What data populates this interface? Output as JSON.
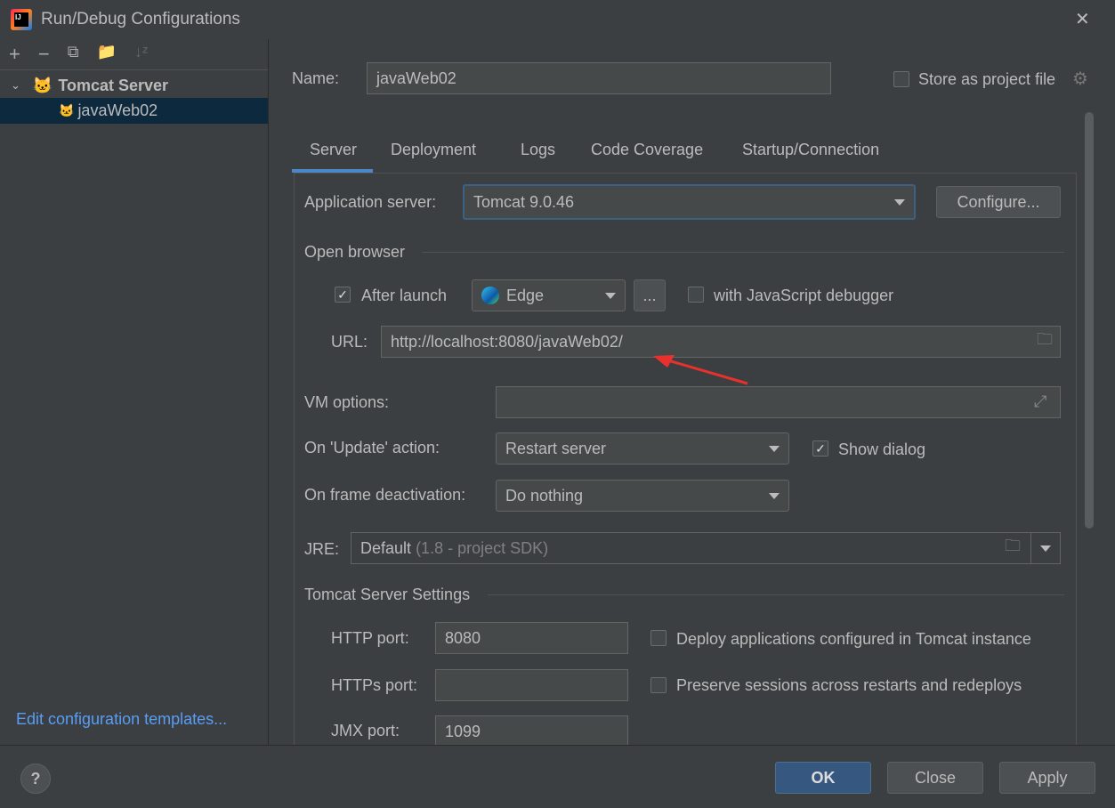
{
  "window": {
    "title": "Run/Debug Configurations",
    "close": "✕"
  },
  "sidebar": {
    "toolbar": [
      "add",
      "remove",
      "copy",
      "new-folder",
      "sort"
    ],
    "tree": {
      "group": "Tomcat Server",
      "item": "javaWeb02"
    },
    "edit_templates": "Edit configuration templates..."
  },
  "header": {
    "name_label": "Name:",
    "name_value": "javaWeb02",
    "store_label": "Store as project file",
    "store_checked": false
  },
  "tabs": [
    "Server",
    "Deployment",
    "Logs",
    "Code Coverage",
    "Startup/Connection"
  ],
  "server": {
    "app_server_label": "Application server:",
    "app_server_value": "Tomcat 9.0.46",
    "configure": "Configure...",
    "open_browser": "Open browser",
    "after_launch": "After launch",
    "after_launch_checked": true,
    "browser": "Edge",
    "more": "...",
    "js_debugger": "with JavaScript debugger",
    "js_debugger_checked": false,
    "url_label": "URL:",
    "url_value": "http://localhost:8080/javaWeb02/",
    "vm_label": "VM options:",
    "vm_value": "",
    "update_label": "On 'Update' action:",
    "update_value": "Restart server",
    "show_dialog": "Show dialog",
    "show_dialog_checked": true,
    "frame_label": "On frame deactivation:",
    "frame_value": "Do nothing",
    "jre_label": "JRE:",
    "jre_value": "Default",
    "jre_hint": "(1.8 - project SDK)",
    "tomcat_settings": "Tomcat Server Settings",
    "http_label": "HTTP port:",
    "http_value": "8080",
    "https_label": "HTTPs port:",
    "https_value": "",
    "jmx_label": "JMX port:",
    "jmx_value": "1099",
    "deploy_label": "Deploy applications configured in Tomcat instance",
    "deploy_checked": false,
    "preserve_label": "Preserve sessions across restarts and redeploys",
    "preserve_checked": false
  },
  "footer": {
    "help": "?",
    "ok": "OK",
    "close": "Close",
    "apply": "Apply"
  },
  "colors": {
    "accent": "#4a88c7",
    "selection": "#0d293e",
    "ok": "#365880",
    "annotation": "#e8312c"
  }
}
